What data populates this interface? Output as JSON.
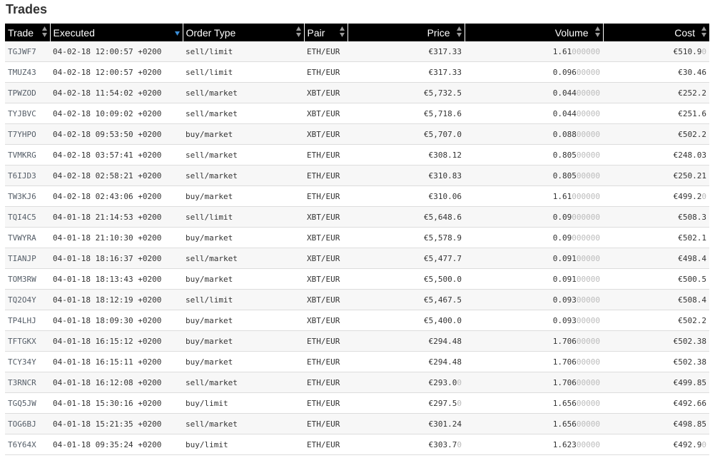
{
  "page": {
    "title": "Trades"
  },
  "columns": [
    {
      "key": "trade",
      "label": "Trade",
      "sort": "both"
    },
    {
      "key": "executed",
      "label": "Executed",
      "sort": "desc"
    },
    {
      "key": "order_type",
      "label": "Order Type",
      "sort": "both"
    },
    {
      "key": "pair",
      "label": "Pair",
      "sort": "both"
    },
    {
      "key": "price",
      "label": "Price",
      "sort": "both"
    },
    {
      "key": "volume",
      "label": "Volume",
      "sort": "both"
    },
    {
      "key": "cost",
      "label": "Cost",
      "sort": "both"
    }
  ],
  "colors": {
    "header_bg": "#000000",
    "sort_active": "#3b8fd9",
    "dim_digits": "#bbbbbb"
  },
  "rows": [
    {
      "trade": "TGJWF7",
      "executed": "04-02-18 12:00:57 +0200",
      "order_type": "sell/limit",
      "pair": "ETH/EUR",
      "price": "€317.33",
      "price_dim": "",
      "volume": "1.61",
      "volume_dim": "000000",
      "cost": "€510.9",
      "cost_dim": "0"
    },
    {
      "trade": "TMUZ43",
      "executed": "04-02-18 12:00:57 +0200",
      "order_type": "sell/limit",
      "pair": "ETH/EUR",
      "price": "€317.33",
      "price_dim": "",
      "volume": "0.096",
      "volume_dim": "00000",
      "cost": "€30.46",
      "cost_dim": ""
    },
    {
      "trade": "TPWZOD",
      "executed": "04-02-18 11:54:02 +0200",
      "order_type": "sell/market",
      "pair": "XBT/EUR",
      "price": "€5,732.5",
      "price_dim": "",
      "volume": "0.044",
      "volume_dim": "00000",
      "cost": "€252.2",
      "cost_dim": ""
    },
    {
      "trade": "TYJBVC",
      "executed": "04-02-18 10:09:02 +0200",
      "order_type": "sell/market",
      "pair": "XBT/EUR",
      "price": "€5,718.6",
      "price_dim": "",
      "volume": "0.044",
      "volume_dim": "00000",
      "cost": "€251.6",
      "cost_dim": ""
    },
    {
      "trade": "T7YHPO",
      "executed": "04-02-18 09:53:50 +0200",
      "order_type": "buy/market",
      "pair": "XBT/EUR",
      "price": "€5,707.0",
      "price_dim": "",
      "volume": "0.088",
      "volume_dim": "00000",
      "cost": "€502.2",
      "cost_dim": ""
    },
    {
      "trade": "TVMKRG",
      "executed": "04-02-18 03:57:41 +0200",
      "order_type": "sell/market",
      "pair": "ETH/EUR",
      "price": "€308.12",
      "price_dim": "",
      "volume": "0.805",
      "volume_dim": "00000",
      "cost": "€248.03",
      "cost_dim": ""
    },
    {
      "trade": "T6IJD3",
      "executed": "04-02-18 02:58:21 +0200",
      "order_type": "sell/market",
      "pair": "ETH/EUR",
      "price": "€310.83",
      "price_dim": "",
      "volume": "0.805",
      "volume_dim": "00000",
      "cost": "€250.21",
      "cost_dim": ""
    },
    {
      "trade": "TW3KJ6",
      "executed": "04-02-18 02:43:06 +0200",
      "order_type": "buy/market",
      "pair": "ETH/EUR",
      "price": "€310.06",
      "price_dim": "",
      "volume": "1.61",
      "volume_dim": "000000",
      "cost": "€499.2",
      "cost_dim": "0"
    },
    {
      "trade": "TQI4C5",
      "executed": "04-01-18 21:14:53 +0200",
      "order_type": "sell/limit",
      "pair": "XBT/EUR",
      "price": "€5,648.6",
      "price_dim": "",
      "volume": "0.09",
      "volume_dim": "000000",
      "cost": "€508.3",
      "cost_dim": ""
    },
    {
      "trade": "TVWYRA",
      "executed": "04-01-18 21:10:30 +0200",
      "order_type": "buy/market",
      "pair": "XBT/EUR",
      "price": "€5,578.9",
      "price_dim": "",
      "volume": "0.09",
      "volume_dim": "000000",
      "cost": "€502.1",
      "cost_dim": ""
    },
    {
      "trade": "TIANJP",
      "executed": "04-01-18 18:16:37 +0200",
      "order_type": "sell/market",
      "pair": "XBT/EUR",
      "price": "€5,477.7",
      "price_dim": "",
      "volume": "0.091",
      "volume_dim": "00000",
      "cost": "€498.4",
      "cost_dim": ""
    },
    {
      "trade": "TOM3RW",
      "executed": "04-01-18 18:13:43 +0200",
      "order_type": "buy/market",
      "pair": "XBT/EUR",
      "price": "€5,500.0",
      "price_dim": "",
      "volume": "0.091",
      "volume_dim": "00000",
      "cost": "€500.5",
      "cost_dim": ""
    },
    {
      "trade": "TQ2O4Y",
      "executed": "04-01-18 18:12:19 +0200",
      "order_type": "sell/limit",
      "pair": "XBT/EUR",
      "price": "€5,467.5",
      "price_dim": "",
      "volume": "0.093",
      "volume_dim": "00000",
      "cost": "€508.4",
      "cost_dim": ""
    },
    {
      "trade": "TP4LHJ",
      "executed": "04-01-18 18:09:30 +0200",
      "order_type": "buy/market",
      "pair": "XBT/EUR",
      "price": "€5,400.0",
      "price_dim": "",
      "volume": "0.093",
      "volume_dim": "00000",
      "cost": "€502.2",
      "cost_dim": ""
    },
    {
      "trade": "TFTGKX",
      "executed": "04-01-18 16:15:12 +0200",
      "order_type": "buy/market",
      "pair": "ETH/EUR",
      "price": "€294.48",
      "price_dim": "",
      "volume": "1.706",
      "volume_dim": "00000",
      "cost": "€502.38",
      "cost_dim": ""
    },
    {
      "trade": "TCY34Y",
      "executed": "04-01-18 16:15:11 +0200",
      "order_type": "buy/market",
      "pair": "ETH/EUR",
      "price": "€294.48",
      "price_dim": "",
      "volume": "1.706",
      "volume_dim": "00000",
      "cost": "€502.38",
      "cost_dim": ""
    },
    {
      "trade": "T3RNCR",
      "executed": "04-01-18 16:12:08 +0200",
      "order_type": "sell/market",
      "pair": "ETH/EUR",
      "price": "€293.0",
      "price_dim": "0",
      "volume": "1.706",
      "volume_dim": "00000",
      "cost": "€499.85",
      "cost_dim": ""
    },
    {
      "trade": "TGQ5JW",
      "executed": "04-01-18 15:30:16 +0200",
      "order_type": "buy/limit",
      "pair": "ETH/EUR",
      "price": "€297.5",
      "price_dim": "0",
      "volume": "1.656",
      "volume_dim": "00000",
      "cost": "€492.66",
      "cost_dim": ""
    },
    {
      "trade": "TOG6BJ",
      "executed": "04-01-18 15:21:35 +0200",
      "order_type": "sell/market",
      "pair": "ETH/EUR",
      "price": "€301.24",
      "price_dim": "",
      "volume": "1.656",
      "volume_dim": "00000",
      "cost": "€498.85",
      "cost_dim": ""
    },
    {
      "trade": "T6Y64X",
      "executed": "04-01-18 09:35:24 +0200",
      "order_type": "buy/limit",
      "pair": "ETH/EUR",
      "price": "€303.7",
      "price_dim": "0",
      "volume": "1.623",
      "volume_dim": "00000",
      "cost": "€492.9",
      "cost_dim": "0"
    }
  ]
}
